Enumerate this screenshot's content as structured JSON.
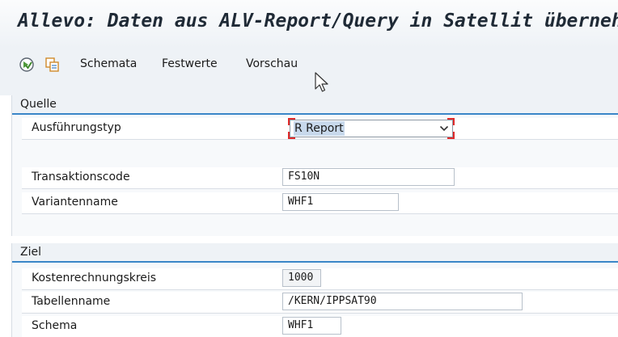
{
  "title": "Allevo: Daten aus ALV-Report/Query in Satellit übernehmen",
  "toolbar": {
    "execute_icon": "execute-icon",
    "copy_icon": "copy-icon",
    "buttons": [
      "Schemata",
      "Festwerte",
      "Vorschau"
    ]
  },
  "quelle": {
    "header": "Quelle",
    "ausfuehrungstyp": {
      "label": "Ausführungstyp",
      "value": "R Report"
    },
    "transaktionscode": {
      "label": "Transaktionscode",
      "value": "FS10N"
    },
    "variantenname": {
      "label": "Variantenname",
      "value": "WHF1"
    }
  },
  "ziel": {
    "header": "Ziel",
    "kostenrechnungskreis": {
      "label": "Kostenrechnungskreis",
      "value": "1000"
    },
    "tabellenname": {
      "label": "Tabellenname",
      "value": "/KERN/IPPSAT90"
    },
    "schema": {
      "label": "Schema",
      "value": "WHF1"
    }
  },
  "colors": {
    "accent": "#3a86c8",
    "required_marker": "#e02a2a",
    "selection": "#c8d9ec"
  }
}
